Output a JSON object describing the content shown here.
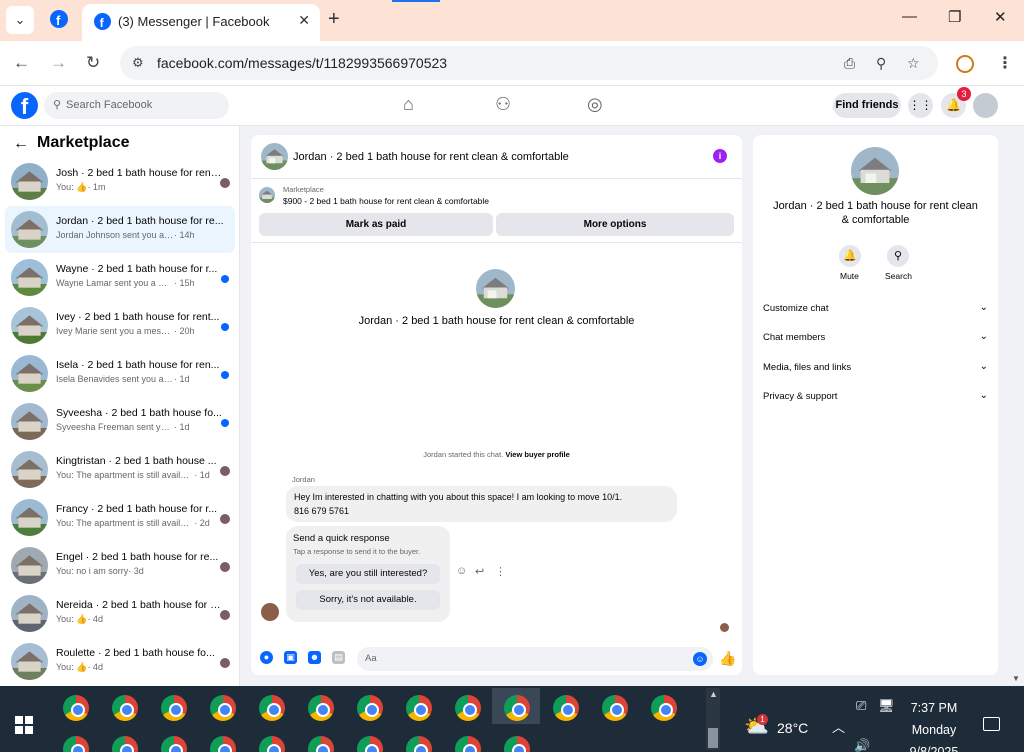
{
  "browser": {
    "tab_title": "(3) Messenger | Facebook",
    "new_tab": "+",
    "url": "facebook.com/messages/t/1182993566970523",
    "minimize": "—",
    "maximize": "❐",
    "close": "✕"
  },
  "fb_header": {
    "search_placeholder": "Search Facebook",
    "find_friends": "Find friends",
    "notification_count": "3"
  },
  "sidebar": {
    "title": "Marketplace",
    "conversations": [
      {
        "name": "Josh · 2 bed 1 bath house for rent ...",
        "prefix": "You:",
        "message": "👍",
        "time": "· 1m",
        "unread": false,
        "active": false
      },
      {
        "name": "Jordan · 2 bed 1 bath house for re...",
        "prefix": "",
        "message": "Jordan Johnson sent you a message ...",
        "time": "· 14h",
        "unread": false,
        "active": true
      },
      {
        "name": "Wayne · 2 bed 1 bath house for r...",
        "prefix": "",
        "message": "Wayne Lamar sent you a message...",
        "time": "· 15h",
        "unread": true,
        "active": false
      },
      {
        "name": "Ivey · 2 bed 1 bath house for rent...",
        "prefix": "",
        "message": "Ivey Marie sent you a message ab...",
        "time": "· 20h",
        "unread": true,
        "active": false
      },
      {
        "name": "Isela · 2 bed 1 bath house for ren...",
        "prefix": "",
        "message": "Isela Benavides sent you a messag...",
        "time": "· 1d",
        "unread": true,
        "active": false
      },
      {
        "name": "Syveesha · 2 bed 1 bath house fo...",
        "prefix": "",
        "message": "Syveesha Freeman sent you a mess...",
        "time": "· 1d",
        "unread": true,
        "active": false
      },
      {
        "name": "Kingtristan · 2 bed 1 bath house ...",
        "prefix": "You:",
        "message": "The apartment is still available...",
        "time": "· 1d",
        "unread": false,
        "active": false
      },
      {
        "name": "Francy · 2 bed 1 bath house for r...",
        "prefix": "You:",
        "message": "The apartment is still available...",
        "time": "· 2d",
        "unread": false,
        "active": false
      },
      {
        "name": "Engel · 2 bed 1 bath house for re...",
        "prefix": "You:",
        "message": "no i am sorry",
        "time": "· 3d",
        "unread": false,
        "active": false
      },
      {
        "name": "Nereida · 2 bed 1 bath house for re...",
        "prefix": "You:",
        "message": "👍",
        "time": "· 4d",
        "unread": false,
        "active": false
      },
      {
        "name": "Roulette · 2 bed 1 bath house fo...",
        "prefix": "You:",
        "message": "👍",
        "time": "· 4d",
        "unread": false,
        "active": false
      }
    ]
  },
  "chat": {
    "title": "Jordan · 2 bed 1 bath house for rent clean & comfortable",
    "marketplace_label": "Marketplace",
    "listing": "$900 - 2 bed 1 bath house for rent clean & comfortable",
    "mark_paid": "Mark as paid",
    "more_options": "More options",
    "started_text": "Jordan started this chat.",
    "view_buyer": "View buyer profile",
    "sender_name": "Jordan",
    "message_line1": "Hey Im interested in chatting with you about this space! I am looking to move 10/1.",
    "message_line2": "816 679 5761",
    "quick_title": "Send a quick response",
    "quick_sub": "Tap a response to send it to the buyer.",
    "quick_opt1": "Yes, are you still interested?",
    "quick_opt2": "Sorry, it's not available.",
    "composer_placeholder": "Aa"
  },
  "details": {
    "title": "Jordan · 2 bed 1 bath house for rent clean & comfortable",
    "mute": "Mute",
    "search": "Search",
    "rows": [
      "Customize chat",
      "Chat members",
      "Media, files and links",
      "Privacy & support"
    ]
  },
  "taskbar": {
    "weather_badge": "1",
    "temperature": "28°C",
    "time": "7:37 PM",
    "day": "Monday",
    "date": "9/8/2025"
  },
  "colors": {
    "facebook_blue": "#0866ff",
    "chrome_tab_strip": "#fde2d6",
    "taskbar": "#1e2b38",
    "info_purple": "#a020f0"
  }
}
